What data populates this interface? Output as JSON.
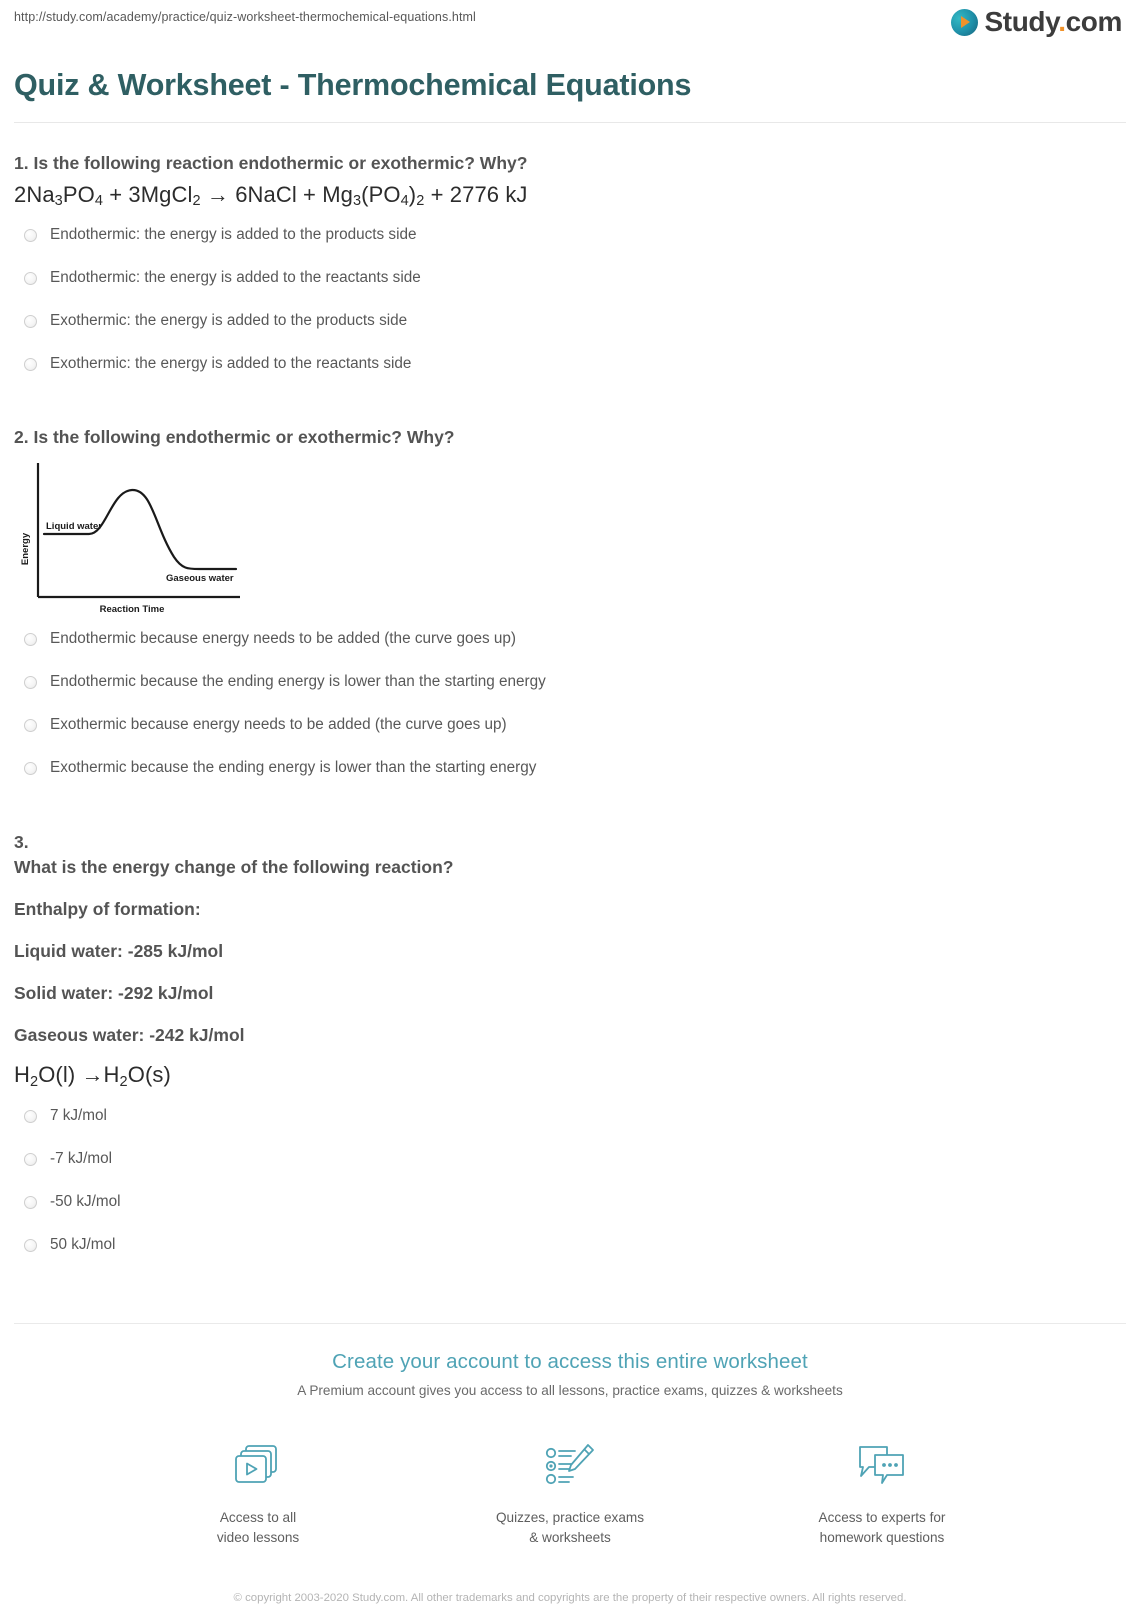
{
  "header": {
    "url": "http://study.com/academy/practice/quiz-worksheet-thermochemical-equations.html",
    "logo_text": "Study",
    "logo_dot": ".",
    "logo_suffix": "com",
    "brand_teal": "#1f8fa8",
    "brand_orange": "#f0922b"
  },
  "page_title": "Quiz & Worksheet - Thermochemical Equations",
  "questions": [
    {
      "number": "1.",
      "prompt": "Is the following reaction endothermic or exothermic? Why?",
      "equation_plain": "2Na3PO4 + 3MgCl2 → 6NaCl + Mg3(PO4)2 + 2776 kJ",
      "options": [
        "Endothermic: the energy is added to the products side",
        "Endothermic: the energy is added to the reactants side",
        "Exothermic: the energy is added to the products side",
        "Exothermic: the energy is added to the reactants side"
      ]
    },
    {
      "number": "2.",
      "prompt": "Is the following endothermic or exothermic? Why?",
      "options": [
        "Endothermic because energy needs to be added (the curve goes up)",
        "Endothermic because the ending energy is lower than the starting energy",
        "Exothermic because energy needs to be added (the curve goes up)",
        "Exothermic because the ending energy is lower than the starting energy"
      ]
    },
    {
      "number": "3.",
      "lines": [
        "What is the energy change of the following reaction?",
        "Enthalpy of formation:",
        "Liquid water: -285 kJ/mol",
        "Solid water: -292 kJ/mol",
        "Gaseous water: -242 kJ/mol"
      ],
      "equation_plain": "H2O(l) →H2O(s)",
      "options": [
        "7 kJ/mol",
        "-7 kJ/mol",
        "-50 kJ/mol",
        "50 kJ/mol"
      ]
    }
  ],
  "chart_data": {
    "type": "line",
    "title": "",
    "xlabel": "Reaction Time",
    "ylabel": "Energy",
    "annotations": [
      "Liquid water",
      "Gaseous water"
    ],
    "grid": false,
    "legend": "none",
    "xlim": [
      0,
      100
    ],
    "ylim": [
      0,
      100
    ],
    "series": [
      {
        "name": "reaction energy profile",
        "x": [
          2,
          26,
          36,
          46,
          52,
          58,
          66,
          74,
          82,
          88,
          100
        ],
        "y": [
          47,
          47,
          62,
          80,
          87,
          85,
          73,
          56,
          38,
          30,
          30
        ]
      }
    ],
    "points_of_interest": {
      "reactant_plateau_energy": 47,
      "activation_peak_energy": 87,
      "product_plateau_energy": 30
    }
  },
  "promo": {
    "headline": "Create your account to access this entire worksheet",
    "subline": "A Premium account gives you access to all lessons, practice exams, quizzes & worksheets",
    "benefits": [
      {
        "icon": "video-lessons-icon",
        "label": "Access to all\nvideo lessons"
      },
      {
        "icon": "quizzes-worksheets-icon",
        "label": "Quizzes, practice exams\n& worksheets"
      },
      {
        "icon": "expert-help-icon",
        "label": "Access to experts for\nhomework questions"
      }
    ],
    "accent_color": "#4fa3b5"
  },
  "copyright": "© copyright 2003-2020 Study.com. All other trademarks and copyrights are the property of their respective owners. All rights reserved."
}
